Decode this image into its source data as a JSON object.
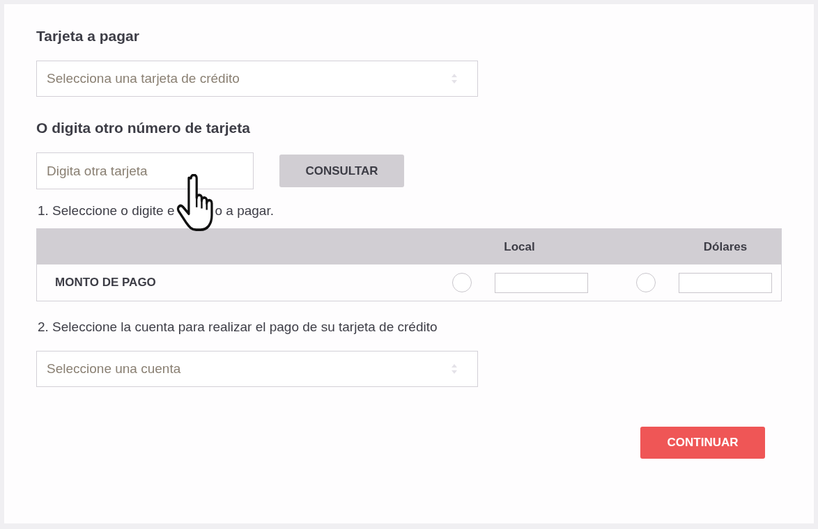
{
  "card_section": {
    "title": "Tarjeta a pagar",
    "select": {
      "placeholder": "Selecciona una tarjeta de crédito"
    }
  },
  "other_card": {
    "title": "O digita otro número de tarjeta",
    "input": {
      "placeholder": "Digita otra tarjeta"
    },
    "button": "CONSULTAR"
  },
  "step_1": {
    "parts": [
      "1. Seleccione o digite e",
      "o a pagar."
    ]
  },
  "amount_table": {
    "columns": [
      "Local",
      "Dólares"
    ],
    "row": {
      "label": "MONTO DE PAGO",
      "options": [
        {
          "selected": false
        },
        {
          "selected": false
        }
      ]
    }
  },
  "step_2": "2. Seleccione la cuenta para realizar el pago de su tarjeta de crédito",
  "account_select": {
    "placeholder": "Seleccione una cuenta"
  },
  "continue_button": "CONTINUAR"
}
